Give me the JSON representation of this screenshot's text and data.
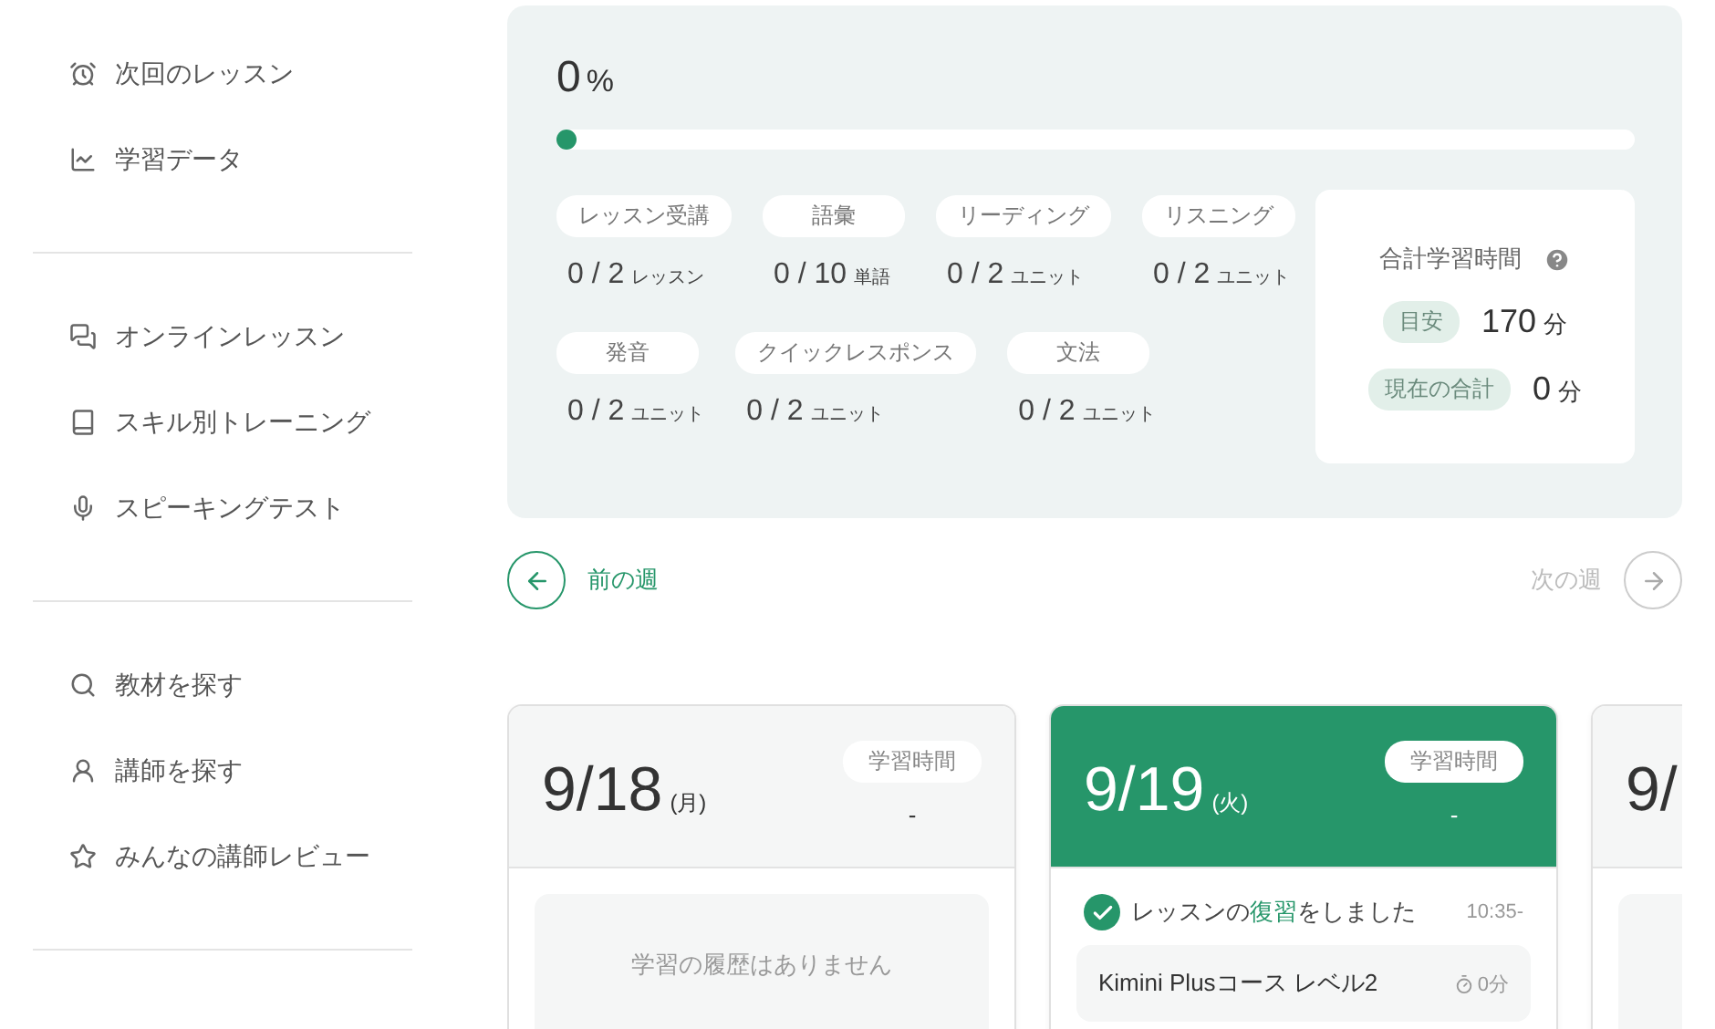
{
  "sidebar": {
    "groups": [
      {
        "items": [
          {
            "label": "次回のレッスン"
          },
          {
            "label": "学習データ"
          }
        ]
      },
      {
        "items": [
          {
            "label": "オンラインレッスン"
          },
          {
            "label": "スキル別トレーニング"
          },
          {
            "label": "スピーキングテスト"
          }
        ]
      },
      {
        "items": [
          {
            "label": "教材を探す"
          },
          {
            "label": "講師を探す"
          },
          {
            "label": "みんなの講師レビュー"
          }
        ]
      }
    ]
  },
  "summary": {
    "percent": "0",
    "percent_unit": "%",
    "level": 0,
    "stat_rows": [
      [
        {
          "label": "レッスン受講",
          "count": "0 / 2",
          "unit": "レッスン"
        },
        {
          "label": "語彙",
          "count": "0 / 10",
          "unit": "単語"
        },
        {
          "label": "リーディング",
          "count": "0 / 2",
          "unit": "ユニット"
        },
        {
          "label": "リスニング",
          "count": "0 / 2",
          "unit": "ユニット"
        }
      ],
      [
        {
          "label": "発音",
          "count": "0 / 2",
          "unit": "ユニット"
        },
        {
          "label": "クイックレスポンス",
          "count": "0 / 2",
          "unit": "ユニット"
        },
        {
          "label": "文法",
          "count": "0 / 2",
          "unit": "ユニット"
        }
      ]
    ],
    "total": {
      "title": "合計学習時間",
      "rows": [
        {
          "label": "目安",
          "value": "170",
          "unit": "分"
        },
        {
          "label": "現在の合計",
          "value": "0",
          "unit": "分"
        }
      ]
    }
  },
  "week_nav": {
    "prev": {
      "label": "前の週",
      "disabled": false
    },
    "next": {
      "label": "次の週",
      "disabled": true
    }
  },
  "days": [
    {
      "date": "9/18",
      "weekday": "(月)",
      "today": false,
      "time_label": "学習時間",
      "time_value": "-",
      "empty_message": "学習の履歴はありません"
    },
    {
      "date": "9/19",
      "weekday": "(火)",
      "today": true,
      "time_label": "学習時間",
      "time_value": "-",
      "activities": [
        {
          "text": "レッスンの**復習**をしました",
          "time": "10:35-",
          "done": true,
          "course": "Kimini Plusコース レベル2",
          "duration": "0分"
        }
      ]
    },
    {
      "date": "9/",
      "today": false
    }
  ]
}
